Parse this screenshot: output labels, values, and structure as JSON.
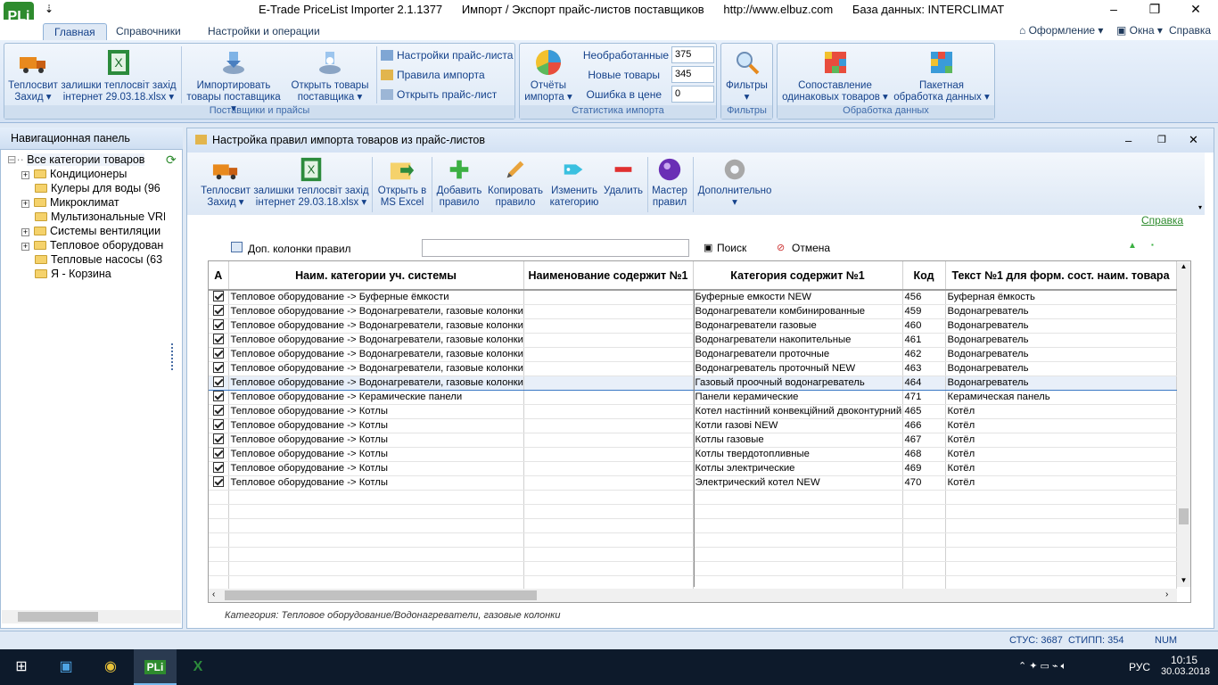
{
  "window": {
    "logo": "PLi",
    "title": "E-Trade PriceList Importer 2.1.1377      Импорт / Экспорт прайс-листов поставщиков      http://www.elbuz.com      База данных: INTERCLIMAT"
  },
  "ribbon_tabs": [
    "Главная",
    "Справочники",
    "Настройки и операции"
  ],
  "ribbon_right": [
    "Оформление",
    "Окна",
    "Справка"
  ],
  "ribbon": {
    "g1_title": "Поставщики и прайсы",
    "teplosvit": [
      "Теплосвит",
      "Захид ▾"
    ],
    "zalishki": [
      "залишки теплосвiт захiд",
      "iнтернет 29.03.18.xlsx ▾"
    ],
    "import_goods": [
      "Импортировать",
      "товары поставщика ▾"
    ],
    "open_goods": [
      "Открыть товары",
      "поставщика ▾"
    ],
    "small": [
      "Настройки прайс-листа",
      "Правила импорта",
      "Открыть прайс-лист"
    ],
    "g2_title": "Статистика импорта",
    "reports": [
      "Отчёты",
      "импорта ▾"
    ],
    "stats": [
      {
        "label": "Необработанные",
        "value": "375"
      },
      {
        "label": "Новые товары",
        "value": "345"
      },
      {
        "label": "Ошибка в цене",
        "value": "0"
      }
    ],
    "g3_title": "Фильтры",
    "filters": [
      "Фильтры",
      "▾"
    ],
    "g4_title": "Обработка данных",
    "compare": [
      "Сопоставление",
      "одинаковых товаров ▾"
    ],
    "batch": [
      "Пакетная",
      "обработка данных ▾"
    ]
  },
  "nav": {
    "header": "Навигационная панель",
    "root": "Все категории товаров",
    "items": [
      {
        "label": "Кондиционеры",
        "expand": "+"
      },
      {
        "label": "Кулеры для воды (96",
        "expand": ""
      },
      {
        "label": "Микроклимат",
        "expand": "+"
      },
      {
        "label": "Мультизональные VRF",
        "expand": ""
      },
      {
        "label": "Системы вентиляции",
        "expand": "+"
      },
      {
        "label": "Тепловое оборудован",
        "expand": "+"
      },
      {
        "label": "Тепловые насосы (63",
        "expand": ""
      },
      {
        "label": "Я - Корзина",
        "expand": ""
      }
    ]
  },
  "inner": {
    "title": "Настройка правил импорта товаров из прайс-листов",
    "toolbar": [
      [
        "Теплосвит",
        "Захид ▾"
      ],
      [
        "залишки теплосвiт захiд",
        "iнтернет 29.03.18.xlsx ▾"
      ],
      [
        "Открыть в",
        "MS Excel"
      ],
      [
        "Добавить",
        "правило"
      ],
      [
        "Копировать",
        "правило"
      ],
      [
        "Изменить",
        "категорию"
      ],
      [
        "Удалить",
        ""
      ],
      [
        "Мастер",
        "правил"
      ],
      [
        "Дополнительно",
        "▾"
      ]
    ],
    "help_link": "Справка",
    "extra_cols": "Доп. колонки правил",
    "search": "Поиск",
    "cancel": "Отмена",
    "search_value": ""
  },
  "grid": {
    "headers": [
      "А",
      "Наим. категории уч. системы",
      "Наименование содержит №1",
      "Категория содержит №1",
      "Код",
      "Текст №1 для форм. сост. наим. товара"
    ],
    "rows": [
      [
        "Тепловое оборудование -> Буферные ёмкости",
        "",
        "Буферные емкости     NEW",
        "456",
        "Буферная ёмкость"
      ],
      [
        "Тепловое оборудование -> Водонагреватели, газовые колонки",
        "",
        "Водонагреватели комбинированные",
        "459",
        "Водонагреватель"
      ],
      [
        "Тепловое оборудование -> Водонагреватели, газовые колонки",
        "",
        "Водонагреватели газовые",
        "460",
        "Водонагреватель"
      ],
      [
        "Тепловое оборудование -> Водонагреватели, газовые колонки",
        "",
        "Водонагреватели накопительные",
        "461",
        "Водонагреватель"
      ],
      [
        "Тепловое оборудование -> Водонагреватели, газовые колонки",
        "",
        "Водонагреватели проточные",
        "462",
        "Водонагреватель"
      ],
      [
        "Тепловое оборудование -> Водонагреватели, газовые колонки",
        "",
        "Водонагреватель проточный     NEW",
        "463",
        "Водонагреватель"
      ],
      [
        "Тепловое оборудование -> Водонагреватели, газовые колонки",
        "",
        "Газовый проочный водонагреватель",
        "464",
        "Водонагреватель"
      ],
      [
        "Тепловое оборудование -> Керамические панели",
        "",
        "Панели керамические",
        "471",
        "Керамическая панель"
      ],
      [
        "Тепловое оборудование -> Котлы",
        "",
        "Котел настінний конвекційний двоконтурний",
        "465",
        "Котёл"
      ],
      [
        "Тепловое оборудование -> Котлы",
        "",
        "Котли газові              NEW",
        "466",
        "Котёл"
      ],
      [
        "Тепловое оборудование -> Котлы",
        "",
        "Котлы газовые",
        "467",
        "Котёл"
      ],
      [
        "Тепловое оборудование -> Котлы",
        "",
        "Котлы твердотопливные",
        "468",
        "Котёл"
      ],
      [
        "Тепловое оборудование -> Котлы",
        "",
        "Котлы электрические",
        "469",
        "Котёл"
      ],
      [
        "Тепловое оборудование -> Котлы",
        "",
        "Электрический котел NEW",
        "470",
        "Котёл"
      ]
    ],
    "selected_row": 6
  },
  "footer_category": "Категория: Тепловое оборудование/Водонагреватели, газовые колонки",
  "status": {
    "stus": "СТУС: 3687",
    "stipp": "СТИПП: 354",
    "num": "NUM"
  },
  "taskbar": {
    "lang": "РУС",
    "time": "10:15",
    "date": "30.03.2018"
  }
}
